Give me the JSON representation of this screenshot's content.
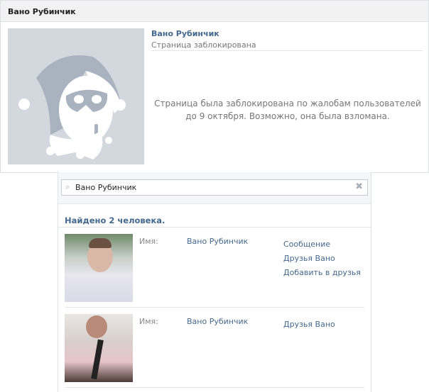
{
  "profile": {
    "header_title": "Вано Рубинчик",
    "name": "Вано Рубинчик",
    "status": "Страница заблокирована",
    "message": "Страница была заблокирована по жалобам пользователей до 9 октября. Возможно, она была взломана."
  },
  "search": {
    "value": "Вано Рубинчик",
    "icon": "search-icon",
    "clear_icon": "clear-icon",
    "found": "Найдено 2 человека."
  },
  "results": [
    {
      "label": "Имя:",
      "name": "Вано Рубинчик",
      "actions": [
        "Сообщение",
        "Друзья Вано",
        "Добавить в друзья"
      ]
    },
    {
      "label": "Имя:",
      "name": "Вано Рубинчик",
      "actions": [
        "Друзья Вано"
      ]
    }
  ]
}
